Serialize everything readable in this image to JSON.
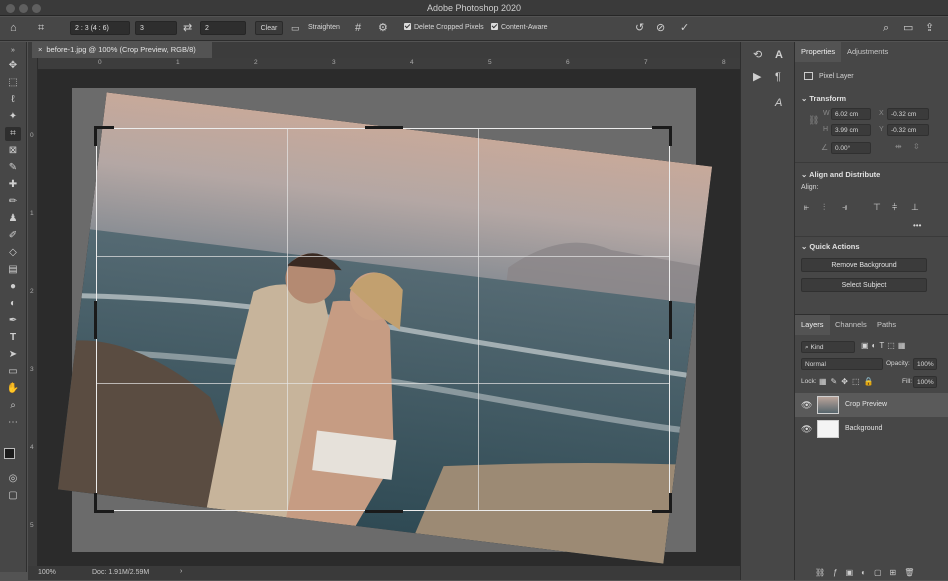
{
  "window": {
    "title": "Adobe Photoshop 2020"
  },
  "options": {
    "ratio_select": "2 : 3 (4 : 6)",
    "width_value": "3",
    "swap_icon": "swap-arrows-icon",
    "height_value": "2",
    "clear_label": "Clear",
    "straighten_label": "Straighten",
    "delete_cropped_label": "Delete Cropped Pixels",
    "content_aware_label": "Content-Aware"
  },
  "document": {
    "tab_label": "before-1.jpg @ 100% (Crop Preview, RGB/8)",
    "ruler_top": [
      "0",
      "1",
      "2",
      "3",
      "4",
      "5",
      "6",
      "7",
      "8"
    ],
    "ruler_left": [
      "0",
      "1",
      "2",
      "3",
      "4",
      "5"
    ]
  },
  "status": {
    "zoom": "100%",
    "doc_info": "Doc: 1.91M/2.59M",
    "arrow": "›"
  },
  "properties": {
    "tab_properties": "Properties",
    "tab_adjustments": "Adjustments",
    "pixel_layer_label": "Pixel Layer",
    "transform_label": "Transform",
    "w_label": "W",
    "w_value": "6.02 cm",
    "x_label": "X",
    "x_value": "-0.32 cm",
    "h_label": "H",
    "h_value": "3.99 cm",
    "y_label": "Y",
    "y_value": "-0.32 cm",
    "angle_value": "0.00°",
    "align_label": "Align and Distribute",
    "align_sub": "Align:",
    "more_label": "•••",
    "quick_actions_label": "Quick Actions",
    "remove_bg_label": "Remove Background",
    "select_subject_label": "Select Subject"
  },
  "layers": {
    "tab_layers": "Layers",
    "tab_channels": "Channels",
    "tab_paths": "Paths",
    "kind_label": "Kind",
    "blend_mode": "Normal",
    "opacity_label": "Opacity:",
    "opacity_value": "100%",
    "lock_label": "Lock:",
    "fill_label": "Fill:",
    "fill_value": "100%",
    "items": [
      {
        "name": "Crop Preview"
      },
      {
        "name": "Background"
      }
    ]
  }
}
